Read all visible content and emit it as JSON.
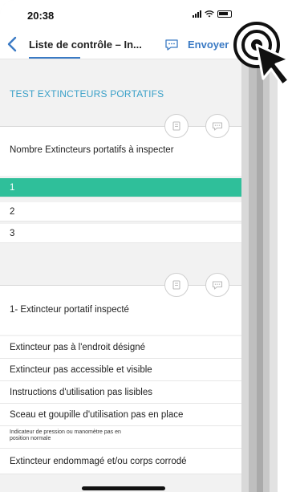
{
  "status": {
    "time": "20:38"
  },
  "nav": {
    "title": "Liste de contrôle – In...",
    "send_label": "Envoyer"
  },
  "section1": {
    "title": "TEST EXTINCTEURS PORTATIFS",
    "question": "Nombre Extincteurs portatifs à inspecter",
    "options": [
      "1",
      "2",
      "3"
    ],
    "selected_index": 0
  },
  "section2": {
    "question": "1- Extincteur portatif inspecté",
    "items": [
      "Extincteur pas à l'endroit désigné",
      "Extincteur pas accessible et visible",
      "Instructions d'utilisation pas lisibles",
      "Sceau et goupille d'utilisation pas en place",
      "Indicateur de pression ou manomètre pas en position normale",
      "Extincteur endommagé et/ou corps corrodé"
    ]
  },
  "colors": {
    "accent": "#3a7ac4",
    "selected": "#2fbf9a",
    "section_title": "#3aa0c8"
  },
  "icons": [
    "back-chevron-icon",
    "comment-icon",
    "note-icon",
    "chat-bubble-icon",
    "cursor-arrow-icon",
    "signal-icon",
    "wifi-icon",
    "battery-icon"
  ]
}
